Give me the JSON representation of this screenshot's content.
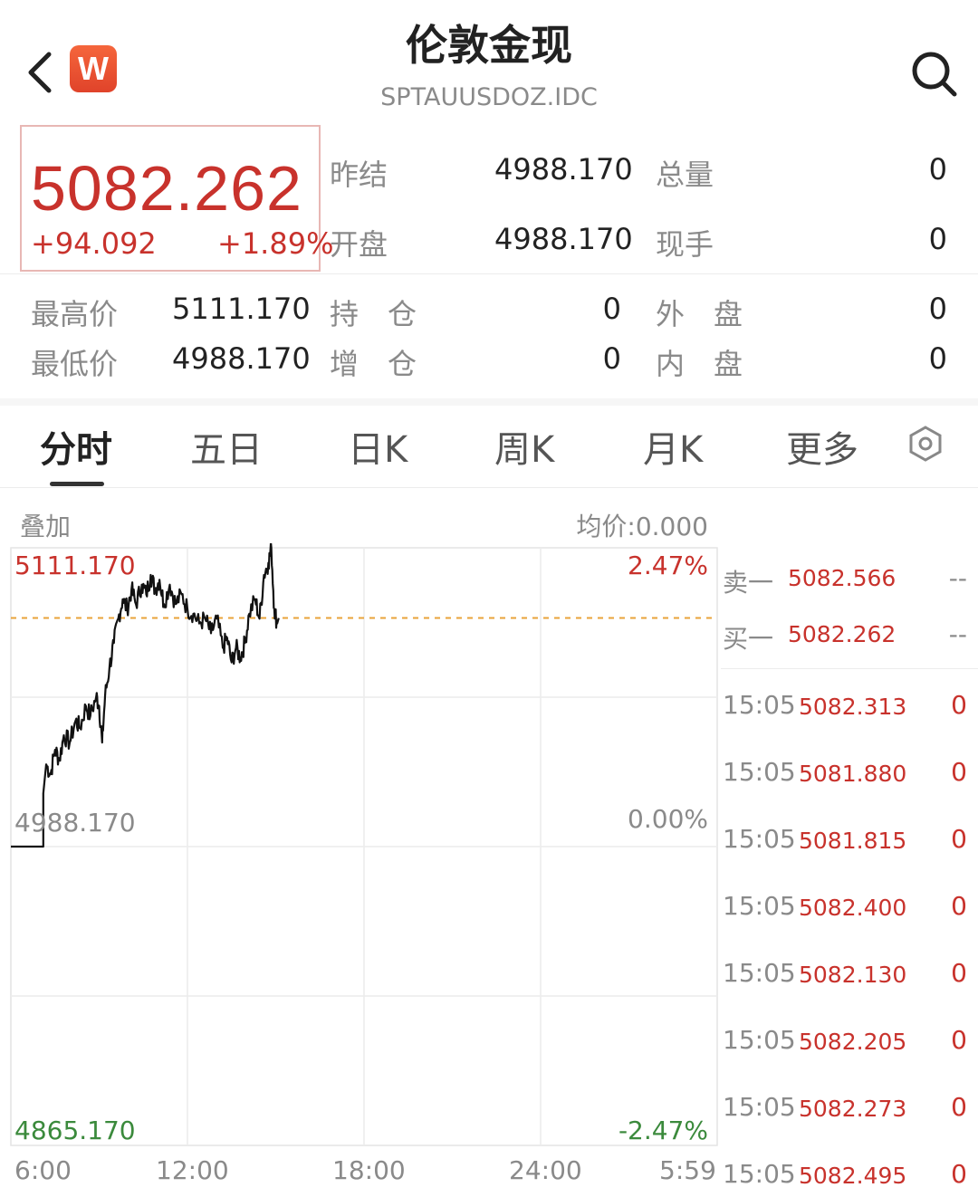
{
  "header": {
    "title": "伦敦金现",
    "code": "SPTAUUSDOZ.IDC",
    "logo_text": "W"
  },
  "quote": {
    "price": "5082.262",
    "change": "+94.092",
    "change_pct": "+1.89%",
    "stats_top": [
      {
        "label": "昨结",
        "value": "4988.170"
      },
      {
        "label": "总量",
        "value": "0"
      },
      {
        "label": "开盘",
        "value": "4988.170"
      },
      {
        "label": "现手",
        "value": "0"
      }
    ],
    "stats_bottom": [
      {
        "label": "最高价",
        "value": "5111.170"
      },
      {
        "label": "持　仓",
        "value": "0"
      },
      {
        "label": "外　盘",
        "value": "0"
      },
      {
        "label": "最低价",
        "value": "4988.170"
      },
      {
        "label": "增　仓",
        "value": "0"
      },
      {
        "label": "内　盘",
        "value": "0"
      }
    ]
  },
  "tabs": [
    "分时",
    "五日",
    "日K",
    "周K",
    "月K",
    "更多"
  ],
  "chart": {
    "overlay_label": "叠加",
    "avg_label": "均价:0.000",
    "y_high": "5111.170",
    "y_mid": "4988.170",
    "y_low": "4865.170",
    "pct_high": "2.47%",
    "pct_mid": "0.00%",
    "pct_low": "-2.47%",
    "x_labels": [
      "6:00",
      "12:00",
      "18:00",
      "24:00",
      "5:59"
    ]
  },
  "chart_data": {
    "type": "line",
    "ylim": [
      4865.17,
      5111.17
    ],
    "prev_close": 4988.17,
    "xlim_hours": [
      0,
      24
    ],
    "series": [
      {
        "values": [
          [
            0.0,
            4988.17
          ],
          [
            1.1,
            4988.17
          ],
          [
            1.1,
            5010
          ],
          [
            1.2,
            5022
          ],
          [
            1.35,
            5018
          ],
          [
            1.5,
            5028
          ],
          [
            1.65,
            5024
          ],
          [
            1.8,
            5034
          ],
          [
            2.0,
            5031
          ],
          [
            2.2,
            5040
          ],
          [
            2.35,
            5037
          ],
          [
            2.55,
            5046
          ],
          [
            2.7,
            5042
          ],
          [
            2.9,
            5050
          ],
          [
            3.0,
            5046
          ],
          [
            3.1,
            5031
          ],
          [
            3.2,
            5050
          ],
          [
            3.35,
            5062
          ],
          [
            3.5,
            5072
          ],
          [
            3.65,
            5082
          ],
          [
            3.8,
            5090
          ],
          [
            3.95,
            5086
          ],
          [
            4.1,
            5094
          ],
          [
            4.25,
            5088
          ],
          [
            4.45,
            5096
          ],
          [
            4.6,
            5092
          ],
          [
            4.75,
            5100
          ],
          [
            4.9,
            5094
          ],
          [
            5.05,
            5098
          ],
          [
            5.2,
            5088
          ],
          [
            5.4,
            5096
          ],
          [
            5.6,
            5088
          ],
          [
            5.8,
            5092
          ],
          [
            6.0,
            5086
          ],
          [
            6.2,
            5084
          ],
          [
            6.4,
            5080
          ],
          [
            6.6,
            5082
          ],
          [
            6.8,
            5076
          ],
          [
            7.0,
            5082
          ],
          [
            7.2,
            5070
          ],
          [
            7.35,
            5074
          ],
          [
            7.5,
            5064
          ],
          [
            7.65,
            5070
          ],
          [
            7.8,
            5066
          ],
          [
            7.95,
            5072
          ],
          [
            8.1,
            5084
          ],
          [
            8.3,
            5090
          ],
          [
            8.45,
            5082
          ],
          [
            8.6,
            5100
          ],
          [
            8.75,
            5105
          ],
          [
            8.85,
            5111.17
          ],
          [
            8.95,
            5086
          ],
          [
            9.05,
            5080
          ],
          [
            9.1,
            5082.262
          ]
        ]
      }
    ]
  },
  "orderbook": [
    {
      "label": "卖一",
      "price": "5082.566",
      "vol": "--"
    },
    {
      "label": "买一",
      "price": "5082.262",
      "vol": "--"
    }
  ],
  "trades": [
    {
      "time": "15:05",
      "price": "5082.313",
      "vol": "0"
    },
    {
      "time": "15:05",
      "price": "5081.880",
      "vol": "0"
    },
    {
      "time": "15:05",
      "price": "5081.815",
      "vol": "0"
    },
    {
      "time": "15:05",
      "price": "5082.400",
      "vol": "0"
    },
    {
      "time": "15:05",
      "price": "5082.130",
      "vol": "0"
    },
    {
      "time": "15:05",
      "price": "5082.205",
      "vol": "0"
    },
    {
      "time": "15:05",
      "price": "5082.273",
      "vol": "0"
    },
    {
      "time": "15:05",
      "price": "5082.495",
      "vol": "0"
    }
  ],
  "colors": {
    "up": "#c8322c",
    "down": "#3b8a3c",
    "avg_line": "#e8a33a",
    "line": "#111111"
  }
}
